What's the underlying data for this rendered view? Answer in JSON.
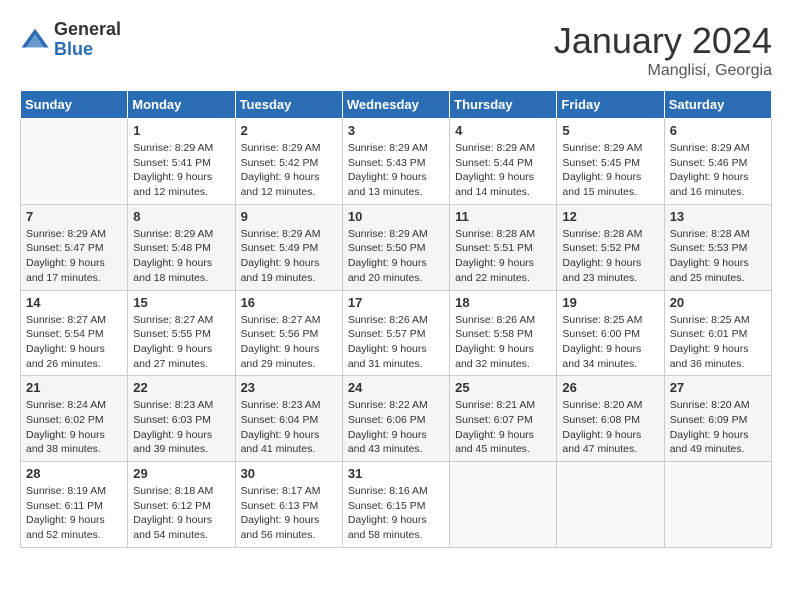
{
  "logo": {
    "general": "General",
    "blue": "Blue"
  },
  "title": "January 2024",
  "location": "Manglisi, Georgia",
  "days_of_week": [
    "Sunday",
    "Monday",
    "Tuesday",
    "Wednesday",
    "Thursday",
    "Friday",
    "Saturday"
  ],
  "weeks": [
    [
      {
        "day": "",
        "sunrise": "",
        "sunset": "",
        "daylight": ""
      },
      {
        "day": "1",
        "sunrise": "Sunrise: 8:29 AM",
        "sunset": "Sunset: 5:41 PM",
        "daylight": "Daylight: 9 hours and 12 minutes."
      },
      {
        "day": "2",
        "sunrise": "Sunrise: 8:29 AM",
        "sunset": "Sunset: 5:42 PM",
        "daylight": "Daylight: 9 hours and 12 minutes."
      },
      {
        "day": "3",
        "sunrise": "Sunrise: 8:29 AM",
        "sunset": "Sunset: 5:43 PM",
        "daylight": "Daylight: 9 hours and 13 minutes."
      },
      {
        "day": "4",
        "sunrise": "Sunrise: 8:29 AM",
        "sunset": "Sunset: 5:44 PM",
        "daylight": "Daylight: 9 hours and 14 minutes."
      },
      {
        "day": "5",
        "sunrise": "Sunrise: 8:29 AM",
        "sunset": "Sunset: 5:45 PM",
        "daylight": "Daylight: 9 hours and 15 minutes."
      },
      {
        "day": "6",
        "sunrise": "Sunrise: 8:29 AM",
        "sunset": "Sunset: 5:46 PM",
        "daylight": "Daylight: 9 hours and 16 minutes."
      }
    ],
    [
      {
        "day": "7",
        "sunrise": "Sunrise: 8:29 AM",
        "sunset": "Sunset: 5:47 PM",
        "daylight": "Daylight: 9 hours and 17 minutes."
      },
      {
        "day": "8",
        "sunrise": "Sunrise: 8:29 AM",
        "sunset": "Sunset: 5:48 PM",
        "daylight": "Daylight: 9 hours and 18 minutes."
      },
      {
        "day": "9",
        "sunrise": "Sunrise: 8:29 AM",
        "sunset": "Sunset: 5:49 PM",
        "daylight": "Daylight: 9 hours and 19 minutes."
      },
      {
        "day": "10",
        "sunrise": "Sunrise: 8:29 AM",
        "sunset": "Sunset: 5:50 PM",
        "daylight": "Daylight: 9 hours and 20 minutes."
      },
      {
        "day": "11",
        "sunrise": "Sunrise: 8:28 AM",
        "sunset": "Sunset: 5:51 PM",
        "daylight": "Daylight: 9 hours and 22 minutes."
      },
      {
        "day": "12",
        "sunrise": "Sunrise: 8:28 AM",
        "sunset": "Sunset: 5:52 PM",
        "daylight": "Daylight: 9 hours and 23 minutes."
      },
      {
        "day": "13",
        "sunrise": "Sunrise: 8:28 AM",
        "sunset": "Sunset: 5:53 PM",
        "daylight": "Daylight: 9 hours and 25 minutes."
      }
    ],
    [
      {
        "day": "14",
        "sunrise": "Sunrise: 8:27 AM",
        "sunset": "Sunset: 5:54 PM",
        "daylight": "Daylight: 9 hours and 26 minutes."
      },
      {
        "day": "15",
        "sunrise": "Sunrise: 8:27 AM",
        "sunset": "Sunset: 5:55 PM",
        "daylight": "Daylight: 9 hours and 27 minutes."
      },
      {
        "day": "16",
        "sunrise": "Sunrise: 8:27 AM",
        "sunset": "Sunset: 5:56 PM",
        "daylight": "Daylight: 9 hours and 29 minutes."
      },
      {
        "day": "17",
        "sunrise": "Sunrise: 8:26 AM",
        "sunset": "Sunset: 5:57 PM",
        "daylight": "Daylight: 9 hours and 31 minutes."
      },
      {
        "day": "18",
        "sunrise": "Sunrise: 8:26 AM",
        "sunset": "Sunset: 5:58 PM",
        "daylight": "Daylight: 9 hours and 32 minutes."
      },
      {
        "day": "19",
        "sunrise": "Sunrise: 8:25 AM",
        "sunset": "Sunset: 6:00 PM",
        "daylight": "Daylight: 9 hours and 34 minutes."
      },
      {
        "day": "20",
        "sunrise": "Sunrise: 8:25 AM",
        "sunset": "Sunset: 6:01 PM",
        "daylight": "Daylight: 9 hours and 36 minutes."
      }
    ],
    [
      {
        "day": "21",
        "sunrise": "Sunrise: 8:24 AM",
        "sunset": "Sunset: 6:02 PM",
        "daylight": "Daylight: 9 hours and 38 minutes."
      },
      {
        "day": "22",
        "sunrise": "Sunrise: 8:23 AM",
        "sunset": "Sunset: 6:03 PM",
        "daylight": "Daylight: 9 hours and 39 minutes."
      },
      {
        "day": "23",
        "sunrise": "Sunrise: 8:23 AM",
        "sunset": "Sunset: 6:04 PM",
        "daylight": "Daylight: 9 hours and 41 minutes."
      },
      {
        "day": "24",
        "sunrise": "Sunrise: 8:22 AM",
        "sunset": "Sunset: 6:06 PM",
        "daylight": "Daylight: 9 hours and 43 minutes."
      },
      {
        "day": "25",
        "sunrise": "Sunrise: 8:21 AM",
        "sunset": "Sunset: 6:07 PM",
        "daylight": "Daylight: 9 hours and 45 minutes."
      },
      {
        "day": "26",
        "sunrise": "Sunrise: 8:20 AM",
        "sunset": "Sunset: 6:08 PM",
        "daylight": "Daylight: 9 hours and 47 minutes."
      },
      {
        "day": "27",
        "sunrise": "Sunrise: 8:20 AM",
        "sunset": "Sunset: 6:09 PM",
        "daylight": "Daylight: 9 hours and 49 minutes."
      }
    ],
    [
      {
        "day": "28",
        "sunrise": "Sunrise: 8:19 AM",
        "sunset": "Sunset: 6:11 PM",
        "daylight": "Daylight: 9 hours and 52 minutes."
      },
      {
        "day": "29",
        "sunrise": "Sunrise: 8:18 AM",
        "sunset": "Sunset: 6:12 PM",
        "daylight": "Daylight: 9 hours and 54 minutes."
      },
      {
        "day": "30",
        "sunrise": "Sunrise: 8:17 AM",
        "sunset": "Sunset: 6:13 PM",
        "daylight": "Daylight: 9 hours and 56 minutes."
      },
      {
        "day": "31",
        "sunrise": "Sunrise: 8:16 AM",
        "sunset": "Sunset: 6:15 PM",
        "daylight": "Daylight: 9 hours and 58 minutes."
      },
      {
        "day": "",
        "sunrise": "",
        "sunset": "",
        "daylight": ""
      },
      {
        "day": "",
        "sunrise": "",
        "sunset": "",
        "daylight": ""
      },
      {
        "day": "",
        "sunrise": "",
        "sunset": "",
        "daylight": ""
      }
    ]
  ]
}
